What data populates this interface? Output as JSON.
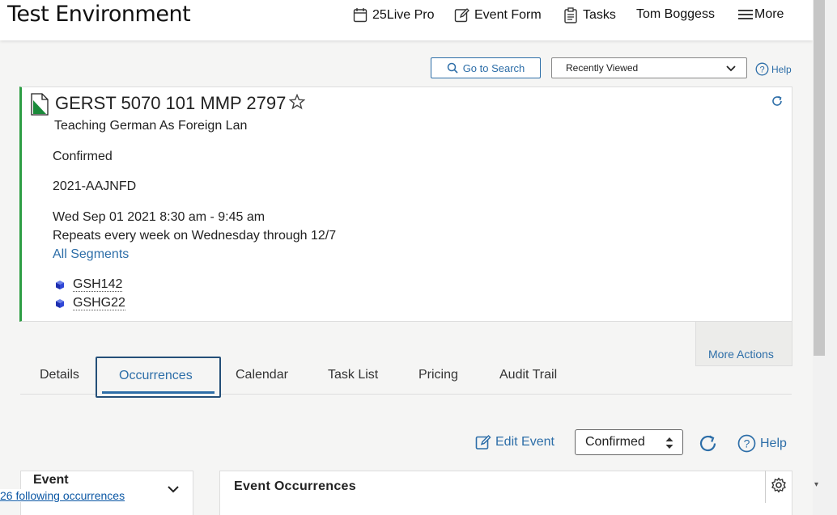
{
  "header": {
    "app_title": "Test Environment",
    "nav": {
      "pro": "25Live Pro",
      "event_form": "Event Form",
      "tasks": "Tasks",
      "user": "Tom Boggess",
      "more": "More"
    }
  },
  "search_bar": {
    "go_to_search": "Go to Search",
    "recently_viewed": "Recently Viewed",
    "help": "Help"
  },
  "event": {
    "title": "GERST 5070 101 MMP 2797",
    "name": "Teaching German As Foreign Lan",
    "state": "Confirmed",
    "reference": "2021-AAJNFD",
    "datetime": "Wed Sep 01 2021 8:30 am - 9:45 am",
    "repeats": "Repeats every week on Wednesday through 12/7",
    "all_segments": "All Segments",
    "locations": [
      "GSH142",
      "GSHG22"
    ],
    "accent_color": "#2e9e44"
  },
  "more_actions": "More Actions",
  "tabs": {
    "details": "Details",
    "occurrences": "Occurrences",
    "calendar": "Calendar",
    "task_list": "Task List",
    "pricing": "Pricing",
    "audit_trail": "Audit Trail",
    "active": "Occurrences"
  },
  "actions": {
    "edit_event": "Edit Event",
    "state_select": "Confirmed",
    "help": "Help"
  },
  "panels": {
    "left_title": "Event",
    "right_title": "Event Occurrences"
  },
  "status_link": "26 following occurrences",
  "colors": {
    "link": "#2d6ea8",
    "active_tab_border": "#244f78"
  }
}
